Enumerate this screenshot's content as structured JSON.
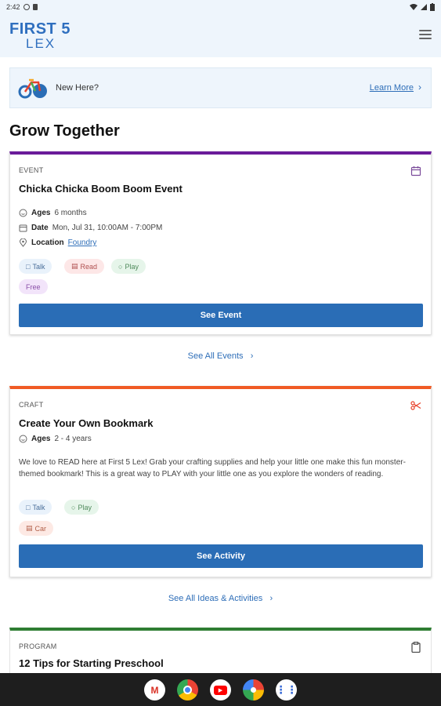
{
  "status_bar": {
    "time": "2:42"
  },
  "header": {
    "logo_top": "FIRST 5",
    "logo_bottom": "LEX"
  },
  "banner": {
    "text": "New Here?",
    "link": "Learn More",
    "chevron": "›"
  },
  "section_title": "Grow Together",
  "event_card": {
    "type": "EVENT",
    "title": "Chicka Chicka Boom Boom Event",
    "ages_label": "Ages",
    "ages_value": "6 months",
    "date_label": "Date",
    "date_value": "Mon, Jul 31, 10:00AM - 7:00PM",
    "location_label": "Location",
    "location_value": "Foundry",
    "chips": [
      "Talk",
      "Read",
      "Play"
    ],
    "price_chip": "Free",
    "button": "See Event"
  },
  "see_all_events": "See All Events",
  "craft_card": {
    "type": "CRAFT",
    "title": "Create Your Own Bookmark",
    "ages_label": "Ages",
    "ages_value": "2 - 4 years",
    "description": "We love to READ here at First 5 Lex! Grab your crafting supplies and help your little one make this fun monster-themed bookmark! This is a great way to PLAY with your little one as you explore the wonders of reading.",
    "chips": [
      "Talk",
      "Play"
    ],
    "location_chip": "Car",
    "button": "See Activity"
  },
  "see_all_ideas": "See All Ideas & Activities",
  "program_card": {
    "type": "PROGRAM",
    "title": "12 Tips for Starting Preschool"
  },
  "colors": {
    "brand_blue": "#2f6fbf",
    "button_blue": "#2a6db6",
    "event_accent": "#6a1b9a",
    "craft_accent": "#f05a24",
    "program_accent": "#2e7d32"
  },
  "dock": [
    "gmail-icon",
    "chrome-icon",
    "youtube-icon",
    "photos-icon",
    "apps-icon"
  ]
}
